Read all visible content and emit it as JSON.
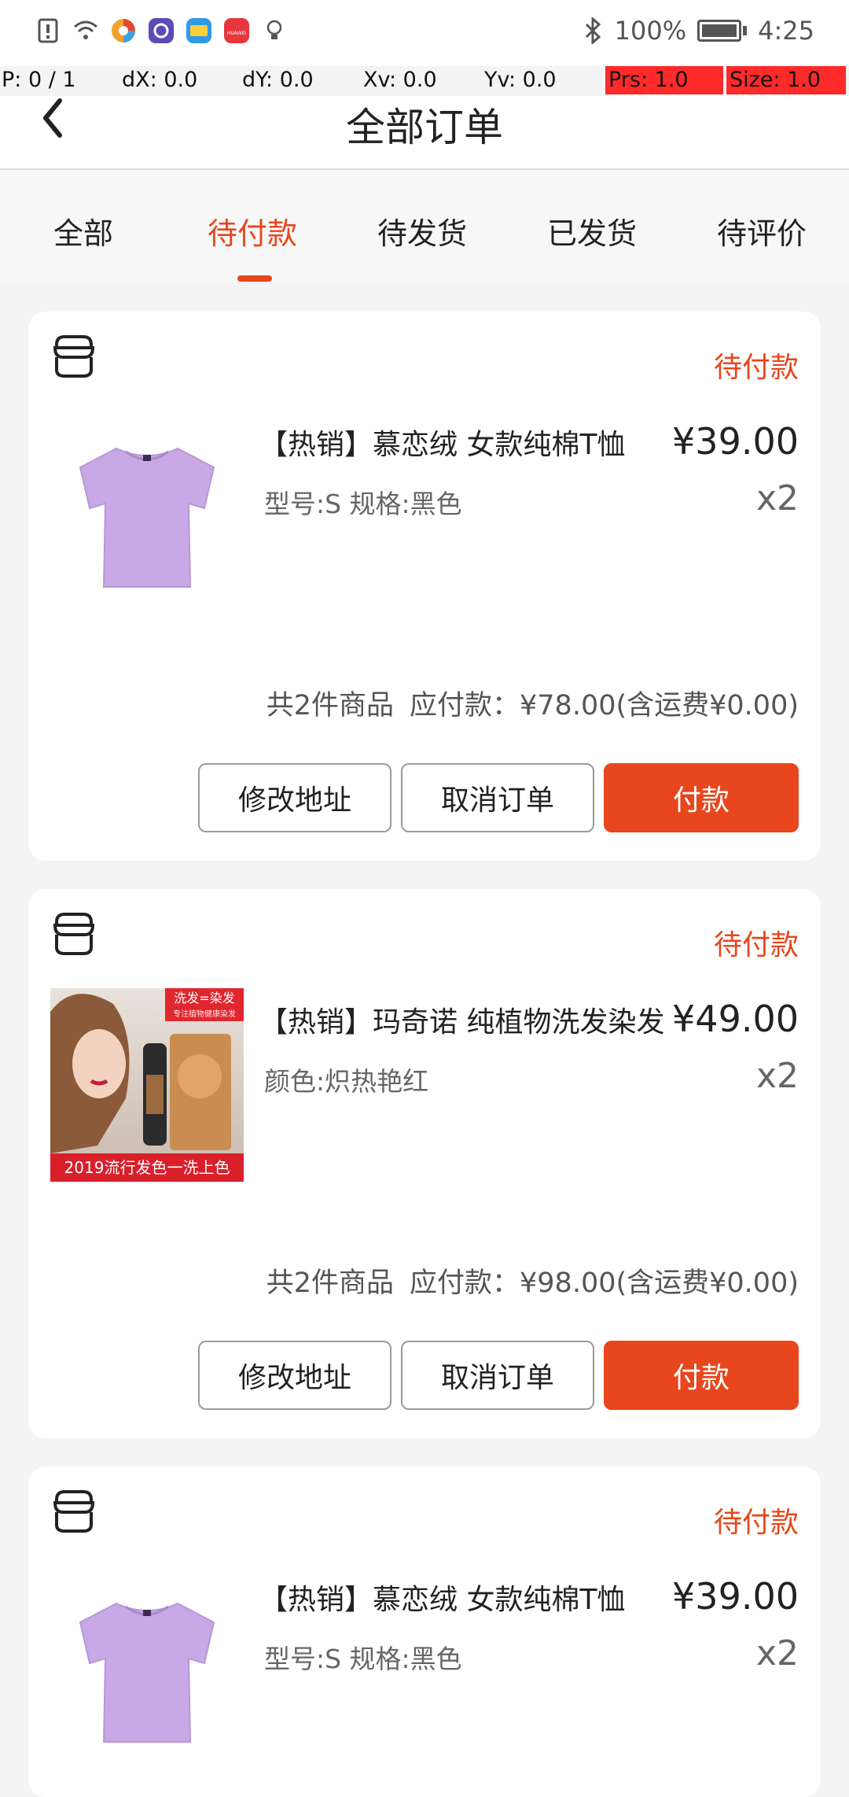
{
  "status_bar": {
    "battery": "100%",
    "time": "4:25",
    "icons": [
      "sim-alert-icon",
      "wifi-icon",
      "browser-icon",
      "app-icon",
      "wallet-icon",
      "huawei-icon",
      "bulb-icon",
      "bluetooth-icon",
      "battery-icon"
    ],
    "huawei_label": "HUAWEI"
  },
  "debug": {
    "p": "P: 0 / 1",
    "dx": "dX: 0.0",
    "dy": "dY: 0.0",
    "xv": "Xv: 0.0",
    "yv": "Yv: 0.0",
    "prs": "Prs: 1.0",
    "size": "Size: 1.0"
  },
  "header": {
    "title": "全部订单",
    "back_icon": "chevron-left-icon"
  },
  "tabs": [
    {
      "label": "全部",
      "active": false
    },
    {
      "label": "待付款",
      "active": true
    },
    {
      "label": "待发货",
      "active": false
    },
    {
      "label": "已发货",
      "active": false
    },
    {
      "label": "待评价",
      "active": false
    }
  ],
  "colors": {
    "accent": "#e8461c",
    "background": "#f4f4f4",
    "card": "#ffffff"
  },
  "orders": [
    {
      "status": "待付款",
      "product_name": "【热销】慕恋绒 女款纯棉T恤",
      "spec": "型号:S 规格:黑色",
      "price": "¥39.00",
      "qty": "x2",
      "count": "共2件商品",
      "payable": "应付款：¥78.00(含运费¥0.00)",
      "buttons": [
        "修改地址",
        "取消订单",
        "付款"
      ],
      "image": "purple-tshirt"
    },
    {
      "status": "待付款",
      "product_name": "【热销】玛奇诺 纯植物洗发染发",
      "spec": "颜色:炽热艳红",
      "price": "¥49.00",
      "qty": "x2",
      "count": "共2件商品",
      "payable": "应付款：¥98.00(含运费¥0.00)",
      "buttons": [
        "修改地址",
        "取消订单",
        "付款"
      ],
      "image": "hair-dye-ad",
      "image_texts": [
        "洗发=染发",
        "专注植物健康染发",
        "2019流行发色一洗上色"
      ]
    },
    {
      "status": "待付款",
      "product_name": "【热销】慕恋绒 女款纯棉T恤",
      "spec": "型号:S 规格:黑色",
      "price": "¥39.00",
      "qty": "x2",
      "image": "purple-tshirt"
    }
  ]
}
